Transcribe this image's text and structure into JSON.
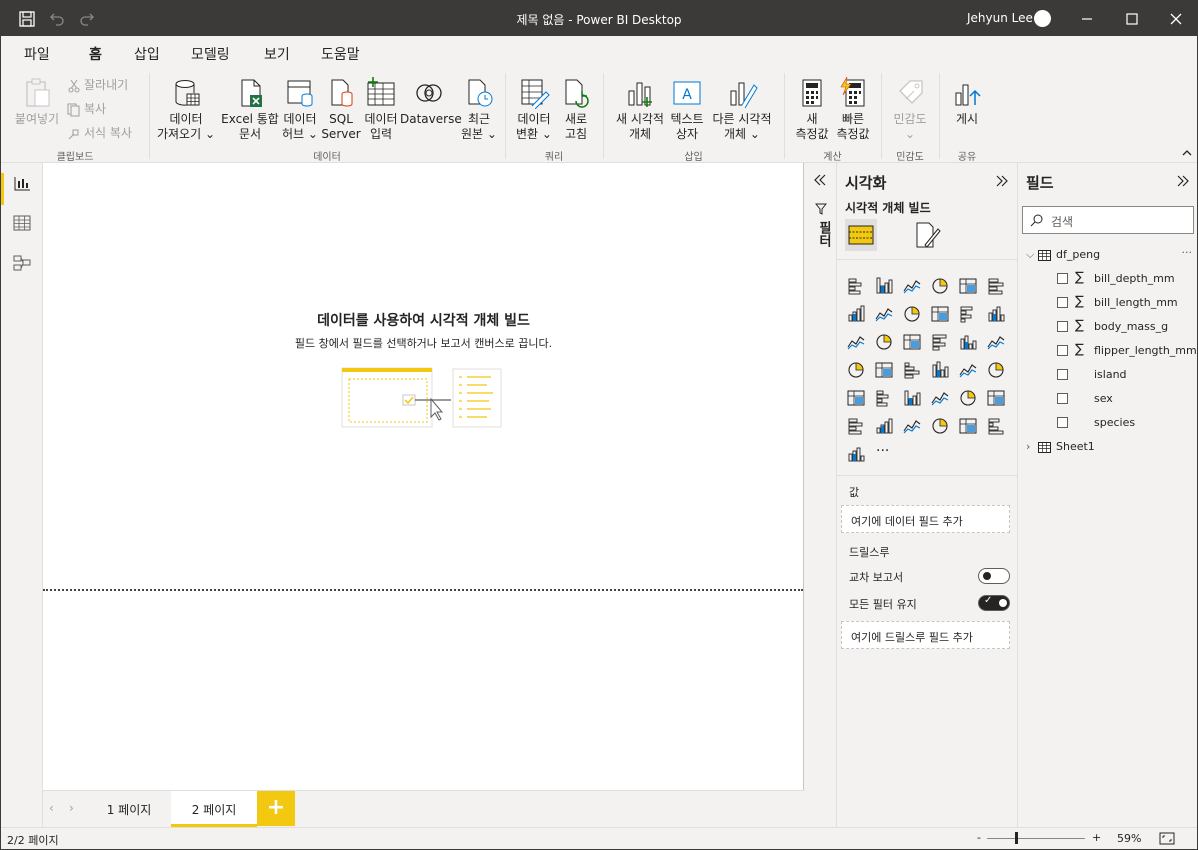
{
  "window": {
    "title": "제목 없음 - Power BI Desktop",
    "user": "Jehyun Lee"
  },
  "menu": {
    "tabs": [
      "파일",
      "홈",
      "삽입",
      "모델링",
      "보기",
      "도움말"
    ],
    "active_index": 1
  },
  "ribbon": {
    "clipboard": {
      "paste": "붙여넣기",
      "cut": "잘라내기",
      "copy": "복사",
      "format_painter": "서식 복사",
      "group": "클립보드"
    },
    "data": {
      "get_data_1": "데이터",
      "get_data_2": "가져오기",
      "excel_1": "Excel 통합",
      "excel_2": "문서",
      "hub_1": "데이터",
      "hub_2": "허브",
      "sql_1": "SQL",
      "sql_2": "Server",
      "enter_1": "데이터",
      "enter_2": "입력",
      "dataverse": "Dataverse",
      "recent_1": "최근",
      "recent_2": "원본",
      "group": "데이터"
    },
    "queries": {
      "transform_1": "데이터",
      "transform_2": "변환",
      "refresh_1": "새로",
      "refresh_2": "고침",
      "group": "쿼리"
    },
    "insert": {
      "newvisual_1": "새 시각적",
      "newvisual_2": "개체",
      "textbox_1": "텍스트",
      "textbox_2": "상자",
      "morevisuals_1": "다른 시각적",
      "morevisuals_2": "개체",
      "group": "삽입"
    },
    "calc": {
      "newmeasure_1": "새",
      "newmeasure_2": "측정값",
      "quickmeasure_1": "빠른",
      "quickmeasure_2": "측정값",
      "group": "계산"
    },
    "sensitivity": {
      "label": "민감도",
      "group": "민감도"
    },
    "share": {
      "publish": "게시",
      "group": "공유"
    }
  },
  "canvas": {
    "empty_title": "데이터를 사용하여 시각적 개체 빌드",
    "empty_subtitle": "필드 창에서 필드를 선택하거나 보고서 캔버스로 끕니다."
  },
  "pages": {
    "tabs": [
      "1 페이지",
      "2 페이지"
    ],
    "active_index": 1,
    "add": "+"
  },
  "status": {
    "page": "2/2 페이지",
    "zoom": "59%",
    "zoom_minus": "-",
    "zoom_plus": "+"
  },
  "filters": {
    "label": "필터"
  },
  "viz": {
    "title": "시각화",
    "subtitle": "시각적 개체 빌드",
    "values_label": "값",
    "values_well": "여기에 데이터 필드 추가",
    "drillthrough_label": "드릴스루",
    "cross_report": "교차 보고서",
    "keep_filters": "모든 필터 유지",
    "drill_well": "여기에 드릴스루 필드 추가",
    "cross_report_on": false,
    "keep_filters_on": true,
    "more": "···",
    "visual_types": [
      "stacked-bar",
      "stacked-column",
      "clustered-bar",
      "clustered-column",
      "100-stacked-bar",
      "100-stacked-column",
      "line",
      "area",
      "stacked-area",
      "line-clustered-column",
      "line-stacked-column",
      "ribbon-chart",
      "waterfall",
      "funnel",
      "scatter",
      "pie",
      "donut",
      "treemap",
      "map",
      "filled-map",
      "gauge",
      "card",
      "multi-row-card",
      "kpi",
      "slicer",
      "table",
      "matrix",
      "r-visual",
      "python-visual",
      "key-influencers",
      "decomposition-tree",
      "qa",
      "smart-narrative",
      "paginated-report",
      "arcgis-map",
      "power-apps",
      "power-automate"
    ]
  },
  "fields": {
    "title": "필드",
    "search_placeholder": "검색",
    "tables": [
      {
        "name": "df_peng",
        "expanded": true,
        "fields": [
          {
            "name": "bill_depth_mm",
            "sigma": true
          },
          {
            "name": "bill_length_mm",
            "sigma": true
          },
          {
            "name": "body_mass_g",
            "sigma": true
          },
          {
            "name": "flipper_length_mm",
            "sigma": true
          },
          {
            "name": "island",
            "sigma": false
          },
          {
            "name": "sex",
            "sigma": false
          },
          {
            "name": "species",
            "sigma": false
          }
        ]
      },
      {
        "name": "Sheet1",
        "expanded": false,
        "fields": []
      }
    ],
    "more": "···"
  },
  "colors": {
    "accent": "#f2c811",
    "titlebar": "#3b3a39",
    "pane": "#f3f2f1"
  }
}
